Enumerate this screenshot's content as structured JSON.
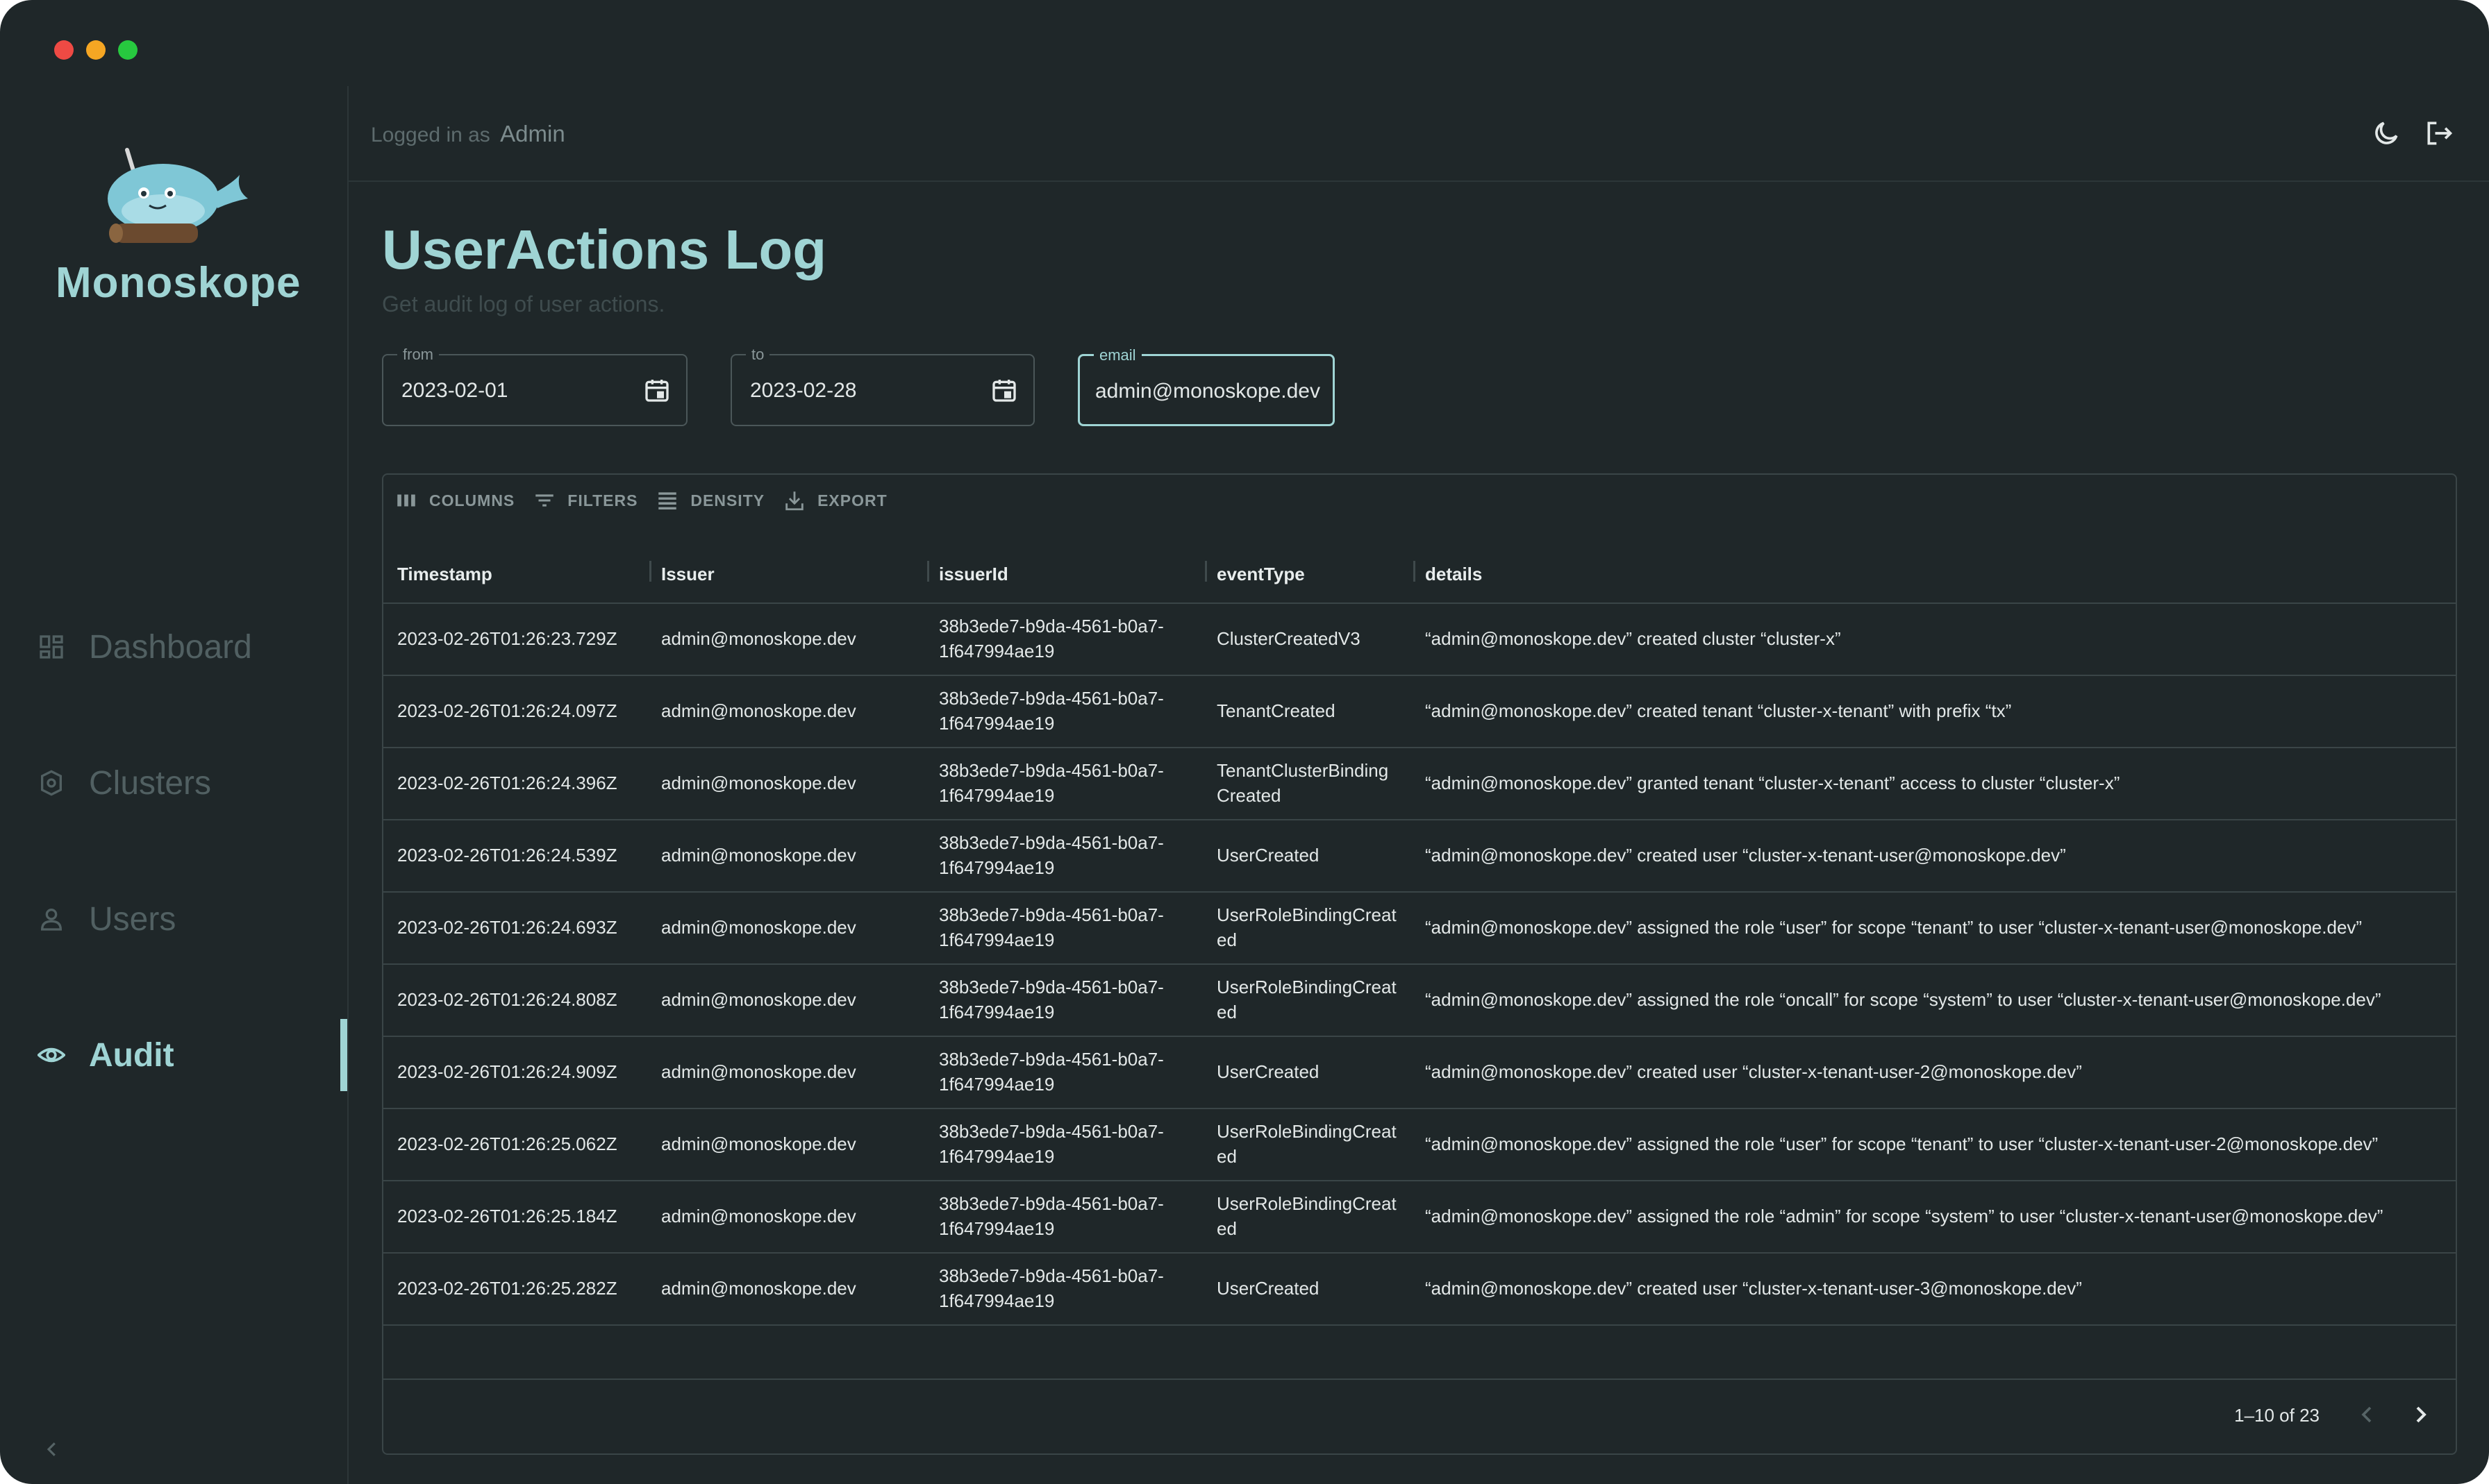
{
  "app": {
    "brand": "Monoskope"
  },
  "sidebar": {
    "items": [
      {
        "label": "Dashboard",
        "icon": "dashboard-icon"
      },
      {
        "label": "Clusters",
        "icon": "clusters-icon"
      },
      {
        "label": "Users",
        "icon": "users-icon"
      },
      {
        "label": "Audit",
        "icon": "eye-icon",
        "active": true
      }
    ]
  },
  "header": {
    "logged_in_prefix": "Logged in as",
    "user": "Admin"
  },
  "page": {
    "title": "UserActions Log",
    "subtitle": "Get audit log of user actions."
  },
  "filters": {
    "from": {
      "label": "from",
      "value": "2023-02-01"
    },
    "to": {
      "label": "to",
      "value": "2023-02-28"
    },
    "email": {
      "label": "email",
      "value": "admin@monoskope.dev"
    }
  },
  "toolbar": {
    "columns": "COLUMNS",
    "filters": "FILTERS",
    "density": "DENSITY",
    "export": "EXPORT"
  },
  "table": {
    "columns": [
      "Timestamp",
      "Issuer",
      "issuerId",
      "eventType",
      "details"
    ],
    "rows": [
      {
        "ts": "2023-02-26T01:26:23.729Z",
        "issuer": "admin@monoskope.dev",
        "id1": "38b3ede7-b9da-4561-b0a7-",
        "id2": "1f647994ae19",
        "ev1": "ClusterCreatedV3",
        "ev2": "",
        "details": "“admin@monoskope.dev” created cluster “cluster-x”"
      },
      {
        "ts": "2023-02-26T01:26:24.097Z",
        "issuer": "admin@monoskope.dev",
        "id1": "38b3ede7-b9da-4561-b0a7-",
        "id2": "1f647994ae19",
        "ev1": "TenantCreated",
        "ev2": "",
        "details": "“admin@monoskope.dev” created tenant “cluster-x-tenant” with prefix “tx”"
      },
      {
        "ts": "2023-02-26T01:26:24.396Z",
        "issuer": "admin@monoskope.dev",
        "id1": "38b3ede7-b9da-4561-b0a7-",
        "id2": "1f647994ae19",
        "ev1": "TenantClusterBinding",
        "ev2": "Created",
        "details": "“admin@monoskope.dev” granted tenant “cluster-x-tenant” access to cluster “cluster-x”"
      },
      {
        "ts": "2023-02-26T01:26:24.539Z",
        "issuer": "admin@monoskope.dev",
        "id1": "38b3ede7-b9da-4561-b0a7-",
        "id2": "1f647994ae19",
        "ev1": "UserCreated",
        "ev2": "",
        "details": "“admin@monoskope.dev” created user “cluster-x-tenant-user@monoskope.dev”"
      },
      {
        "ts": "2023-02-26T01:26:24.693Z",
        "issuer": "admin@monoskope.dev",
        "id1": "38b3ede7-b9da-4561-b0a7-",
        "id2": "1f647994ae19",
        "ev1": "UserRoleBindingCreat",
        "ev2": "ed",
        "details": "“admin@monoskope.dev” assigned the role “user” for scope “tenant” to user “cluster-x-tenant-user@monoskope.dev”"
      },
      {
        "ts": "2023-02-26T01:26:24.808Z",
        "issuer": "admin@monoskope.dev",
        "id1": "38b3ede7-b9da-4561-b0a7-",
        "id2": "1f647994ae19",
        "ev1": "UserRoleBindingCreat",
        "ev2": "ed",
        "details": "“admin@monoskope.dev” assigned the role “oncall” for scope “system” to user “cluster-x-tenant-user@monoskope.dev”"
      },
      {
        "ts": "2023-02-26T01:26:24.909Z",
        "issuer": "admin@monoskope.dev",
        "id1": "38b3ede7-b9da-4561-b0a7-",
        "id2": "1f647994ae19",
        "ev1": "UserCreated",
        "ev2": "",
        "details": "“admin@monoskope.dev” created user “cluster-x-tenant-user-2@monoskope.dev”"
      },
      {
        "ts": "2023-02-26T01:26:25.062Z",
        "issuer": "admin@monoskope.dev",
        "id1": "38b3ede7-b9da-4561-b0a7-",
        "id2": "1f647994ae19",
        "ev1": "UserRoleBindingCreat",
        "ev2": "ed",
        "details": "“admin@monoskope.dev” assigned the role “user” for scope “tenant” to user “cluster-x-tenant-user-2@monoskope.dev”"
      },
      {
        "ts": "2023-02-26T01:26:25.184Z",
        "issuer": "admin@monoskope.dev",
        "id1": "38b3ede7-b9da-4561-b0a7-",
        "id2": "1f647994ae19",
        "ev1": "UserRoleBindingCreat",
        "ev2": "ed",
        "details": "“admin@monoskope.dev” assigned the role “admin” for scope “system” to user “cluster-x-tenant-user@monoskope.dev”"
      },
      {
        "ts": "2023-02-26T01:26:25.282Z",
        "issuer": "admin@monoskope.dev",
        "id1": "38b3ede7-b9da-4561-b0a7-",
        "id2": "1f647994ae19",
        "ev1": "UserCreated",
        "ev2": "",
        "details": "“admin@monoskope.dev” created user “cluster-x-tenant-user-3@monoskope.dev”"
      }
    ]
  },
  "pagination": {
    "info": "1–10 of 23"
  },
  "colors": {
    "accent": "#9fd4d4",
    "background": "#1f2729",
    "border": "#3a4547"
  }
}
